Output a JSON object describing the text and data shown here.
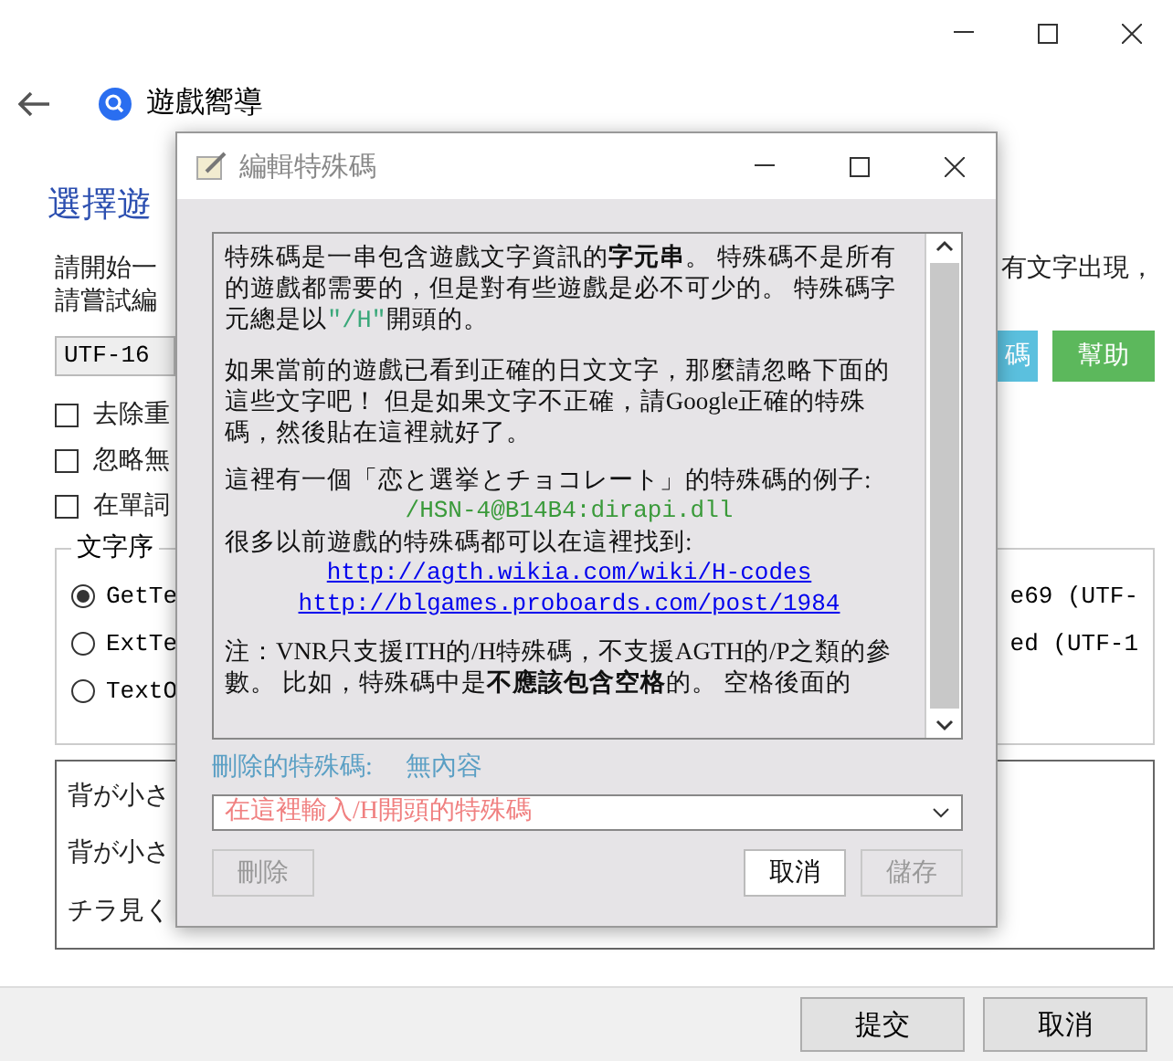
{
  "window": {
    "title": "遊戲嚮導"
  },
  "wizard": {
    "heading": "選擇遊",
    "intro_left": [
      "請開始一",
      "請嘗試編"
    ],
    "intro_right": "有文字出現，",
    "encoding_field": {
      "value": "UTF-16"
    },
    "side_buttons": [
      {
        "label": "碼",
        "kind": "info"
      },
      {
        "label": "幫助",
        "kind": "success"
      }
    ],
    "checkboxes": [
      {
        "label": "去除重",
        "checked": false
      },
      {
        "label": "忽略無",
        "checked": false
      },
      {
        "label": "在單詞",
        "checked": false
      }
    ],
    "group_label": "文字序",
    "radios": [
      {
        "label": "GetTe",
        "right": "e69 (UTF-",
        "selected": true
      },
      {
        "label": "ExtTe",
        "right": "ed (UTF-1",
        "selected": false
      },
      {
        "label": "TextO",
        "selected": false
      }
    ],
    "text_list": [
      "背が小さ",
      "背が小さ",
      "チラ見く"
    ],
    "footer_buttons": [
      "提交",
      "取消"
    ]
  },
  "dialog": {
    "title": "編輯特殊碼",
    "paragraphs": [
      {
        "kind": "text",
        "segments": [
          {
            "kind": "plain",
            "text": "特殊碼是一串包含遊戲文字資訊的"
          },
          {
            "kind": "bold",
            "text": "字元串"
          },
          {
            "kind": "plain",
            "text": "。 特殊碼不是所有的遊戲都需要的，但是對有些遊戲是必不可少的。 特殊碼字元總是以"
          },
          {
            "kind": "code",
            "text": "″/H″"
          },
          {
            "kind": "plain",
            "text": "開頭的。"
          }
        ]
      },
      {
        "kind": "gap"
      },
      {
        "kind": "text",
        "segments": [
          {
            "kind": "plain",
            "text": "如果當前的遊戲已看到正確的日文文字，那麼請忽略下面的這些文字吧！ 但是如果文字不正確，請Google正確的特殊碼，然後貼在這裡就好了。"
          }
        ]
      },
      {
        "kind": "gap"
      },
      {
        "kind": "text",
        "segments": [
          {
            "kind": "plain",
            "text": "這裡有一個「恋と選挙とチョコレート」的特殊碼的例子:"
          }
        ]
      },
      {
        "kind": "code",
        "text": "/HSN-4@B14B4:dirapi.dll"
      },
      {
        "kind": "text",
        "segments": [
          {
            "kind": "plain",
            "text": "很多以前遊戲的特殊碼都可以在這裡找到:"
          }
        ]
      },
      {
        "kind": "link",
        "text": "http://agth.wikia.com/wiki/H-codes"
      },
      {
        "kind": "link",
        "text": "http://blgames.proboards.com/post/1984"
      },
      {
        "kind": "gap"
      },
      {
        "kind": "text",
        "segments": [
          {
            "kind": "plain",
            "text": "注：VNR只支援ITH的/H特殊碼，不支援AGTH的/P之類的參數。 比如，特殊碼中是"
          },
          {
            "kind": "bold",
            "text": "不應該包含空格"
          },
          {
            "kind": "plain",
            "text": "的。 空格後面的"
          }
        ]
      }
    ],
    "deleted_label": "刪除的特殊碼:",
    "deleted_value": "無內容",
    "code_field": {
      "placeholder": "在這裡輸入/H開頭的特殊碼"
    },
    "buttons": [
      {
        "label": "刪除",
        "disabled": true
      },
      {
        "label": "取消",
        "disabled": false
      },
      {
        "label": "儲存",
        "disabled": true
      }
    ]
  }
}
